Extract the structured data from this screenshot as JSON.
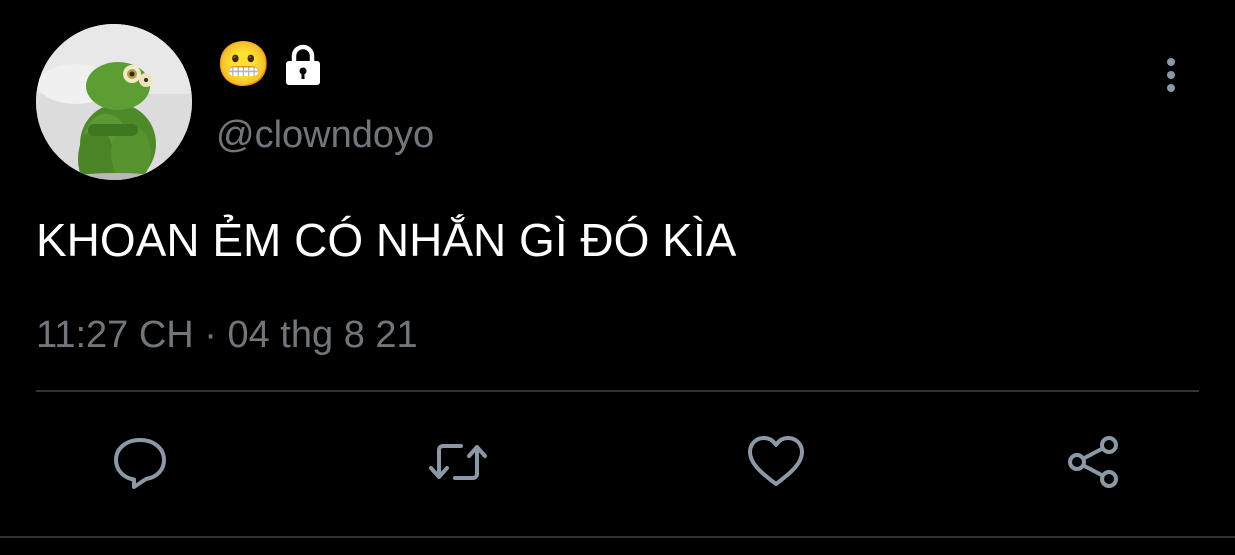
{
  "user": {
    "display_name_emoji": "😬",
    "protected_icon": "lock-icon",
    "handle": "@clowndoyo",
    "avatar_icon": "kermit-avatar"
  },
  "tweet": {
    "text": "KHOAN ẺM CÓ NHẮN GÌ ĐÓ KÌA",
    "timestamp": "11:27 CH · 04 thg 8 21"
  },
  "actions": [
    {
      "name": "reply",
      "icon": "comment-icon"
    },
    {
      "name": "retweet",
      "icon": "retweet-icon"
    },
    {
      "name": "like",
      "icon": "heart-icon"
    },
    {
      "name": "share",
      "icon": "share-icon"
    }
  ],
  "colors": {
    "background": "#000000",
    "text_primary": "#ffffff",
    "text_secondary": "#71767b",
    "icon": "#8b98a5",
    "divider": "#2f3336"
  }
}
